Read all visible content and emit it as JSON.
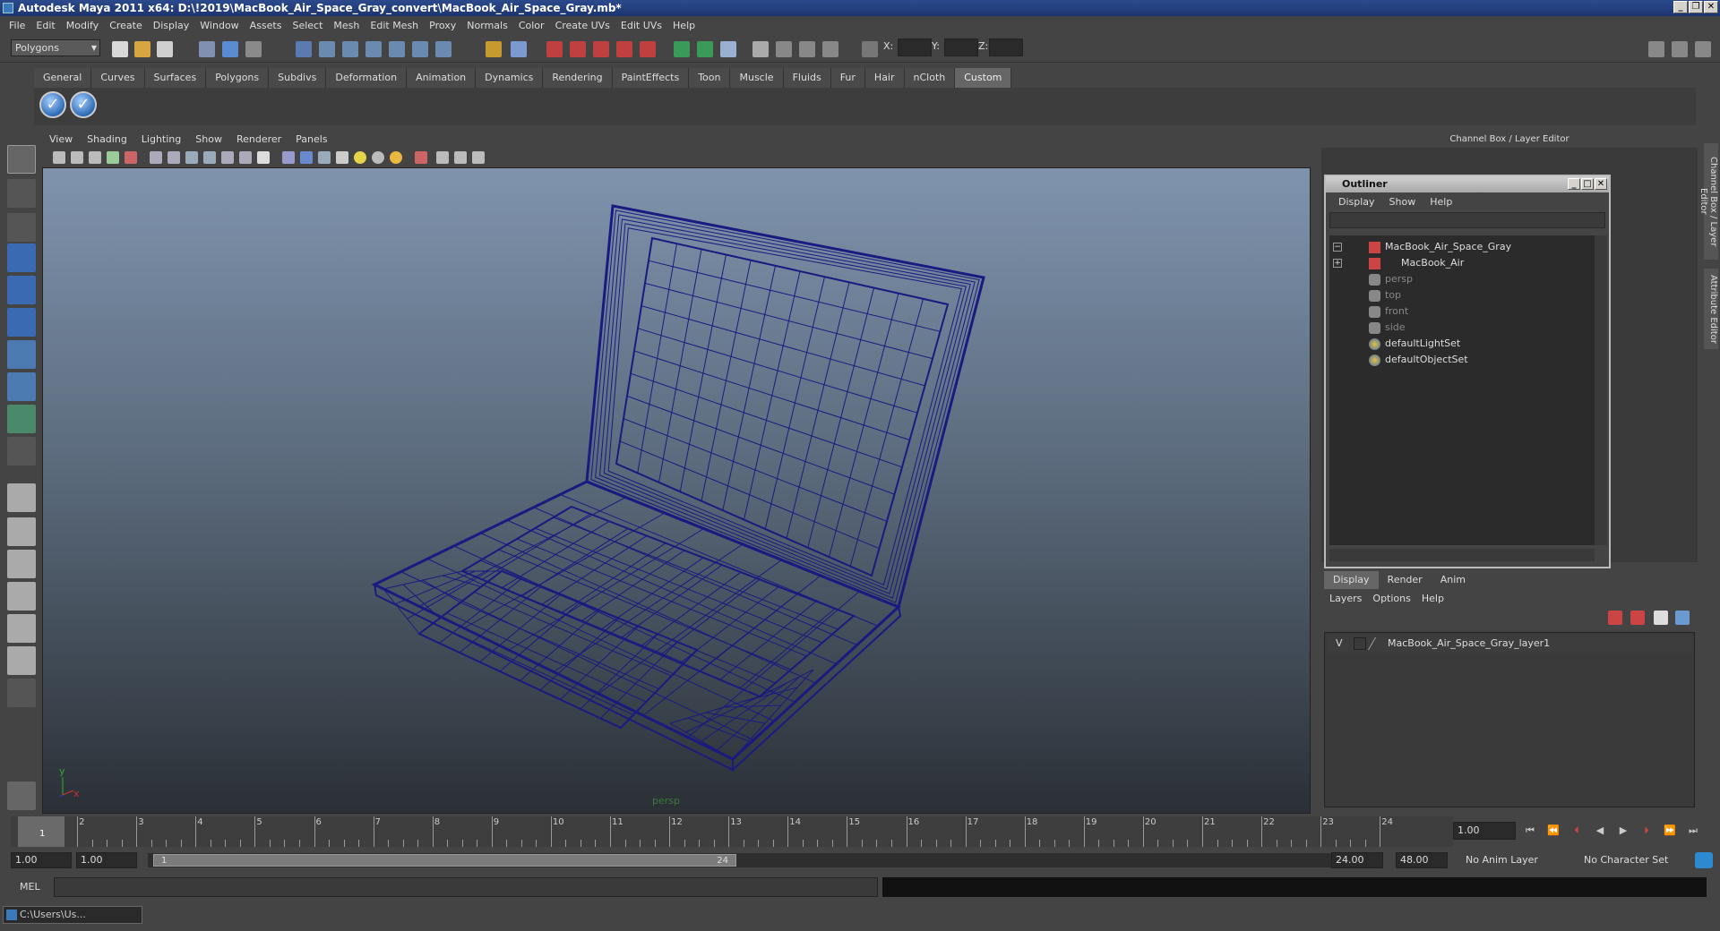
{
  "window": {
    "title": "Autodesk Maya 2011 x64: D:\\!2019\\MacBook_Air_Space_Gray_convert\\MacBook_Air_Space_Gray.mb*"
  },
  "menubar": [
    "File",
    "Edit",
    "Modify",
    "Create",
    "Display",
    "Window",
    "Assets",
    "Select",
    "Mesh",
    "Edit Mesh",
    "Proxy",
    "Normals",
    "Color",
    "Create UVs",
    "Edit UVs",
    "Help"
  ],
  "statusline": {
    "mode": "Polygons",
    "x_label": "X:",
    "y_label": "Y:",
    "z_label": "Z:"
  },
  "shelf": {
    "tabs": [
      "General",
      "Curves",
      "Surfaces",
      "Polygons",
      "Subdivs",
      "Deformation",
      "Animation",
      "Dynamics",
      "Rendering",
      "PaintEffects",
      "Toon",
      "Muscle",
      "Fluids",
      "Fur",
      "Hair",
      "nCloth",
      "Custom"
    ],
    "active_tab": "Custom"
  },
  "viewport": {
    "menu": [
      "View",
      "Shading",
      "Lighting",
      "Show",
      "Renderer",
      "Panels"
    ],
    "camera": "persp",
    "axis_y": "y",
    "axis_x": "x",
    "wire_color": "#1a1a80"
  },
  "channel_box": {
    "title": "Channel Box / Layer Editor"
  },
  "side_tabs": [
    "Channel Box / Layer Editor",
    "Attribute Editor"
  ],
  "outliner": {
    "title": "Outliner",
    "menu": [
      "Display",
      "Show",
      "Help"
    ],
    "items": [
      {
        "label": "MacBook_Air_Space_Gray",
        "icon": "transform-icon",
        "dim": false
      },
      {
        "label": "MacBook_Air",
        "icon": "transform-icon",
        "dim": false
      },
      {
        "label": "persp",
        "icon": "camera-icon",
        "dim": true
      },
      {
        "label": "top",
        "icon": "camera-icon",
        "dim": true
      },
      {
        "label": "front",
        "icon": "camera-icon",
        "dim": true
      },
      {
        "label": "side",
        "icon": "camera-icon",
        "dim": true
      },
      {
        "label": "defaultLightSet",
        "icon": "set-icon",
        "dim": false
      },
      {
        "label": "defaultObjectSet",
        "icon": "set-icon",
        "dim": false
      }
    ]
  },
  "layer_editor": {
    "tabs": [
      "Display",
      "Render",
      "Anim"
    ],
    "active_tab": "Display",
    "menu": [
      "Layers",
      "Options",
      "Help"
    ],
    "layers": [
      {
        "visible": "V",
        "name": "MacBook_Air_Space_Gray_layer1"
      }
    ]
  },
  "time_slider": {
    "ticks": [
      "1",
      "2",
      "3",
      "4",
      "5",
      "6",
      "7",
      "8",
      "9",
      "10",
      "11",
      "12",
      "13",
      "14",
      "15",
      "16",
      "17",
      "18",
      "19",
      "20",
      "21",
      "22",
      "23",
      "24"
    ],
    "current_frame": "1.00",
    "current_marker": "1"
  },
  "range_slider": {
    "start": "1.00",
    "anim_start": "1.00",
    "range_start_label": "1",
    "range_end_label": "24",
    "range_end": "24.00",
    "anim_end": "48.00",
    "anim_layer": "No Anim Layer",
    "character_set": "No Character Set"
  },
  "command_line": {
    "label": "MEL"
  },
  "taskbar": {
    "item": "C:\\Users\\Us..."
  }
}
